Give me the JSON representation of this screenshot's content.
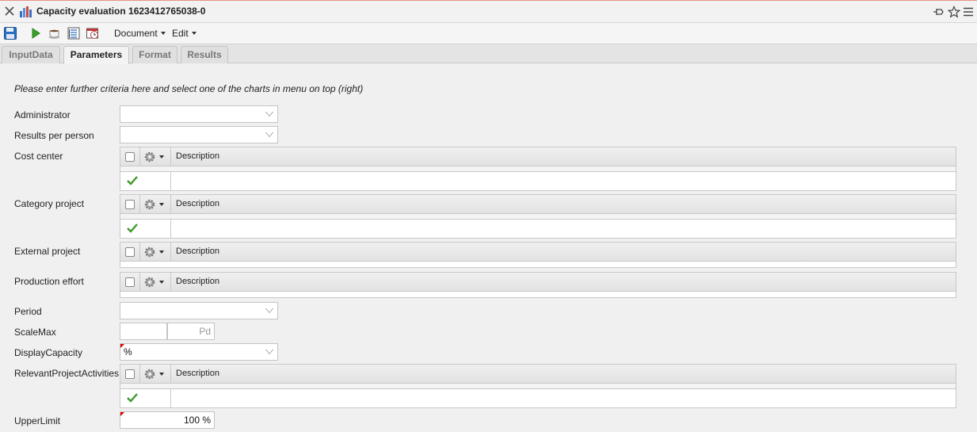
{
  "window": {
    "title": "Capacity evaluation 1623412765038-0"
  },
  "toolbar": {
    "menus": [
      "Document",
      "Edit"
    ]
  },
  "tabs": [
    {
      "label": "InputData",
      "active": false
    },
    {
      "label": "Parameters",
      "active": true
    },
    {
      "label": "Format",
      "active": false
    },
    {
      "label": "Results",
      "active": false
    }
  ],
  "form": {
    "hint": "Please enter further criteria here and select one of the charts in menu on top (right)",
    "fields": {
      "administrator": {
        "label": "Administrator",
        "value": ""
      },
      "results_per_person": {
        "label": "Results per person",
        "value": ""
      },
      "cost_center": {
        "label": "Cost center",
        "column": "Description",
        "rows": [
          {
            "checked": true,
            "description": ""
          }
        ]
      },
      "category_project": {
        "label": "Category project",
        "column": "Description",
        "rows": [
          {
            "checked": true,
            "description": ""
          }
        ]
      },
      "external_project": {
        "label": "External project",
        "column": "Description",
        "rows": []
      },
      "production_effort": {
        "label": "Production effort",
        "column": "Description",
        "rows": []
      },
      "period": {
        "label": "Period",
        "value": ""
      },
      "scale_max": {
        "label": "ScaleMax",
        "value": "",
        "unit": "Pd"
      },
      "display_capacity": {
        "label": "DisplayCapacity",
        "value": "%"
      },
      "relevant_project_activities": {
        "label": "RelevantProjectActivities",
        "column": "Description",
        "rows": [
          {
            "checked": true,
            "description": ""
          }
        ]
      },
      "upper_limit": {
        "label": "UpperLimit",
        "value": "100 %"
      }
    }
  },
  "colors": {
    "accent_check": "#3c9a2a",
    "required_marker": "#dd0000"
  }
}
